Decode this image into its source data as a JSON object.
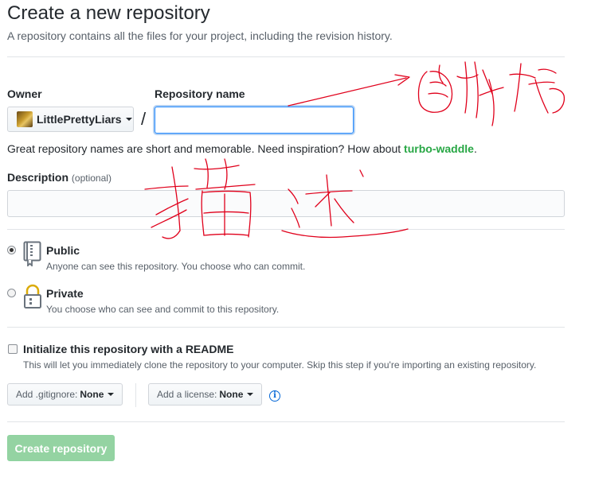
{
  "header": {
    "title": "Create a new repository",
    "subtitle": "A repository contains all the files for your project, including the revision history."
  },
  "owner": {
    "label": "Owner",
    "value": "LittlePrettyLiars"
  },
  "repo_name": {
    "label": "Repository name",
    "value": "",
    "separator": "/"
  },
  "hint": {
    "text": "Great repository names are short and memorable. Need inspiration? How about ",
    "suggestion": "turbo-waddle",
    "suffix": "."
  },
  "description": {
    "label": "Description",
    "optional": "(optional)",
    "value": ""
  },
  "visibility": {
    "public": {
      "title": "Public",
      "note": "Anyone can see this repository. You choose who can commit.",
      "selected": true
    },
    "private": {
      "title": "Private",
      "note": "You choose who can see and commit to this repository.",
      "selected": false
    }
  },
  "init": {
    "title": "Initialize this repository with a README",
    "note": "This will let you immediately clone the repository to your computer. Skip this step if you're importing an existing repository.",
    "checked": false
  },
  "gitignore": {
    "prefix": "Add .gitignore:",
    "value": "None"
  },
  "license": {
    "prefix": "Add a license:",
    "value": "None"
  },
  "submit": {
    "label": "Create repository"
  },
  "colors": {
    "accent_green": "#28a745",
    "disabled_green": "#94d3a2",
    "annotation_red": "#e0001b",
    "focus_blue": "#2188ff"
  },
  "icons": {
    "public": "repo-book-icon",
    "private": "lock-icon",
    "owner_caret": "caret-down-icon",
    "info": "info-icon"
  }
}
